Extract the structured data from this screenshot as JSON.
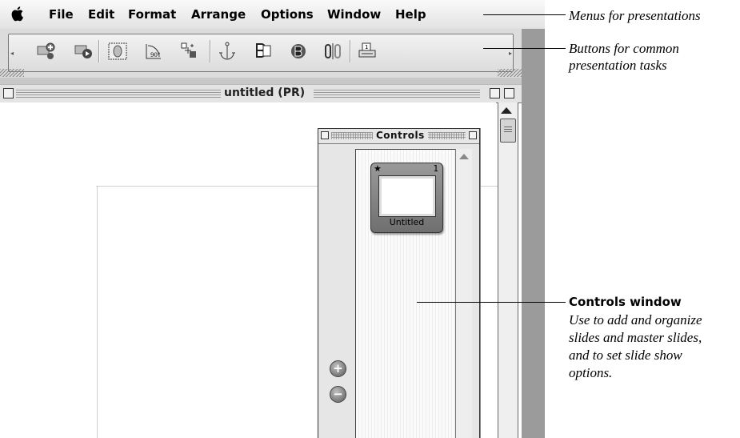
{
  "menubar": {
    "apple_icon": "apple-logo",
    "items": [
      "File",
      "Edit",
      "Format",
      "Arrange",
      "Options",
      "Window",
      "Help"
    ]
  },
  "toolbar": {
    "buttons": [
      "add-slide-icon",
      "play-slideshow-icon",
      "rulers-icon",
      "rotate-90-icon",
      "align-icon",
      "anchor-icon",
      "group-icon",
      "ungroup-icon",
      "link-icon",
      "print-icon"
    ]
  },
  "document": {
    "title": "untitled (PR)"
  },
  "controls": {
    "title": "Controls",
    "slide": {
      "number": "1",
      "name": "Untitled"
    },
    "add_label": "+",
    "remove_label": "−"
  },
  "callouts": {
    "menus": "Menus for presentations",
    "buttons_line1": "Buttons for common",
    "buttons_line2": "presentation tasks",
    "controls_heading": "Controls window",
    "controls_lines": [
      "Use to add and organize",
      "slides and master slides,",
      "and to set slide show",
      "options."
    ]
  },
  "colors": {
    "chrome": "#dcdcdc",
    "gutter": "#9b9b9b"
  }
}
